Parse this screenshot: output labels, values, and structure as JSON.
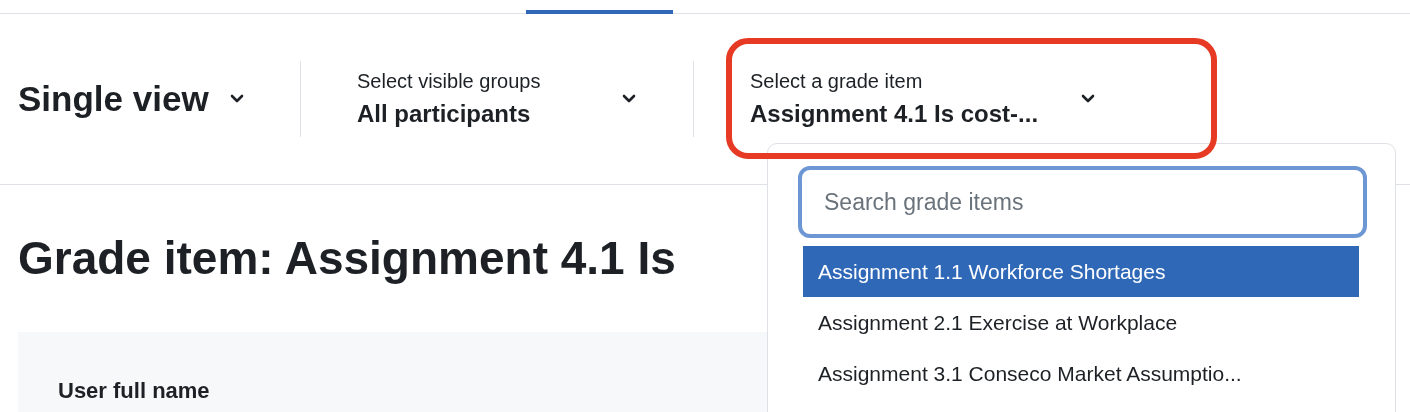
{
  "header": {
    "view_selector": {
      "label": "Single view"
    },
    "group_selector": {
      "label": "Select visible groups",
      "value": "All participants"
    },
    "grade_item_selector": {
      "label": "Select a grade item",
      "value": "Assignment 4.1 Is cost-...",
      "expanded": true,
      "highlighted": true
    }
  },
  "grade_item_dropdown": {
    "search": {
      "placeholder": "Search grade items"
    },
    "items": [
      {
        "label": "Assignment 1.1 Workforce Shortages",
        "selected": true
      },
      {
        "label": "Assignment 2.1 Exercise at Workplace",
        "selected": false
      },
      {
        "label": "Assignment 3.1 Conseco Market Assumptio...",
        "selected": false
      }
    ]
  },
  "page_heading": {
    "visible_start": "Grade item: Assignment 4.1 Is"
  },
  "table": {
    "columns": [
      "User full name"
    ]
  }
}
